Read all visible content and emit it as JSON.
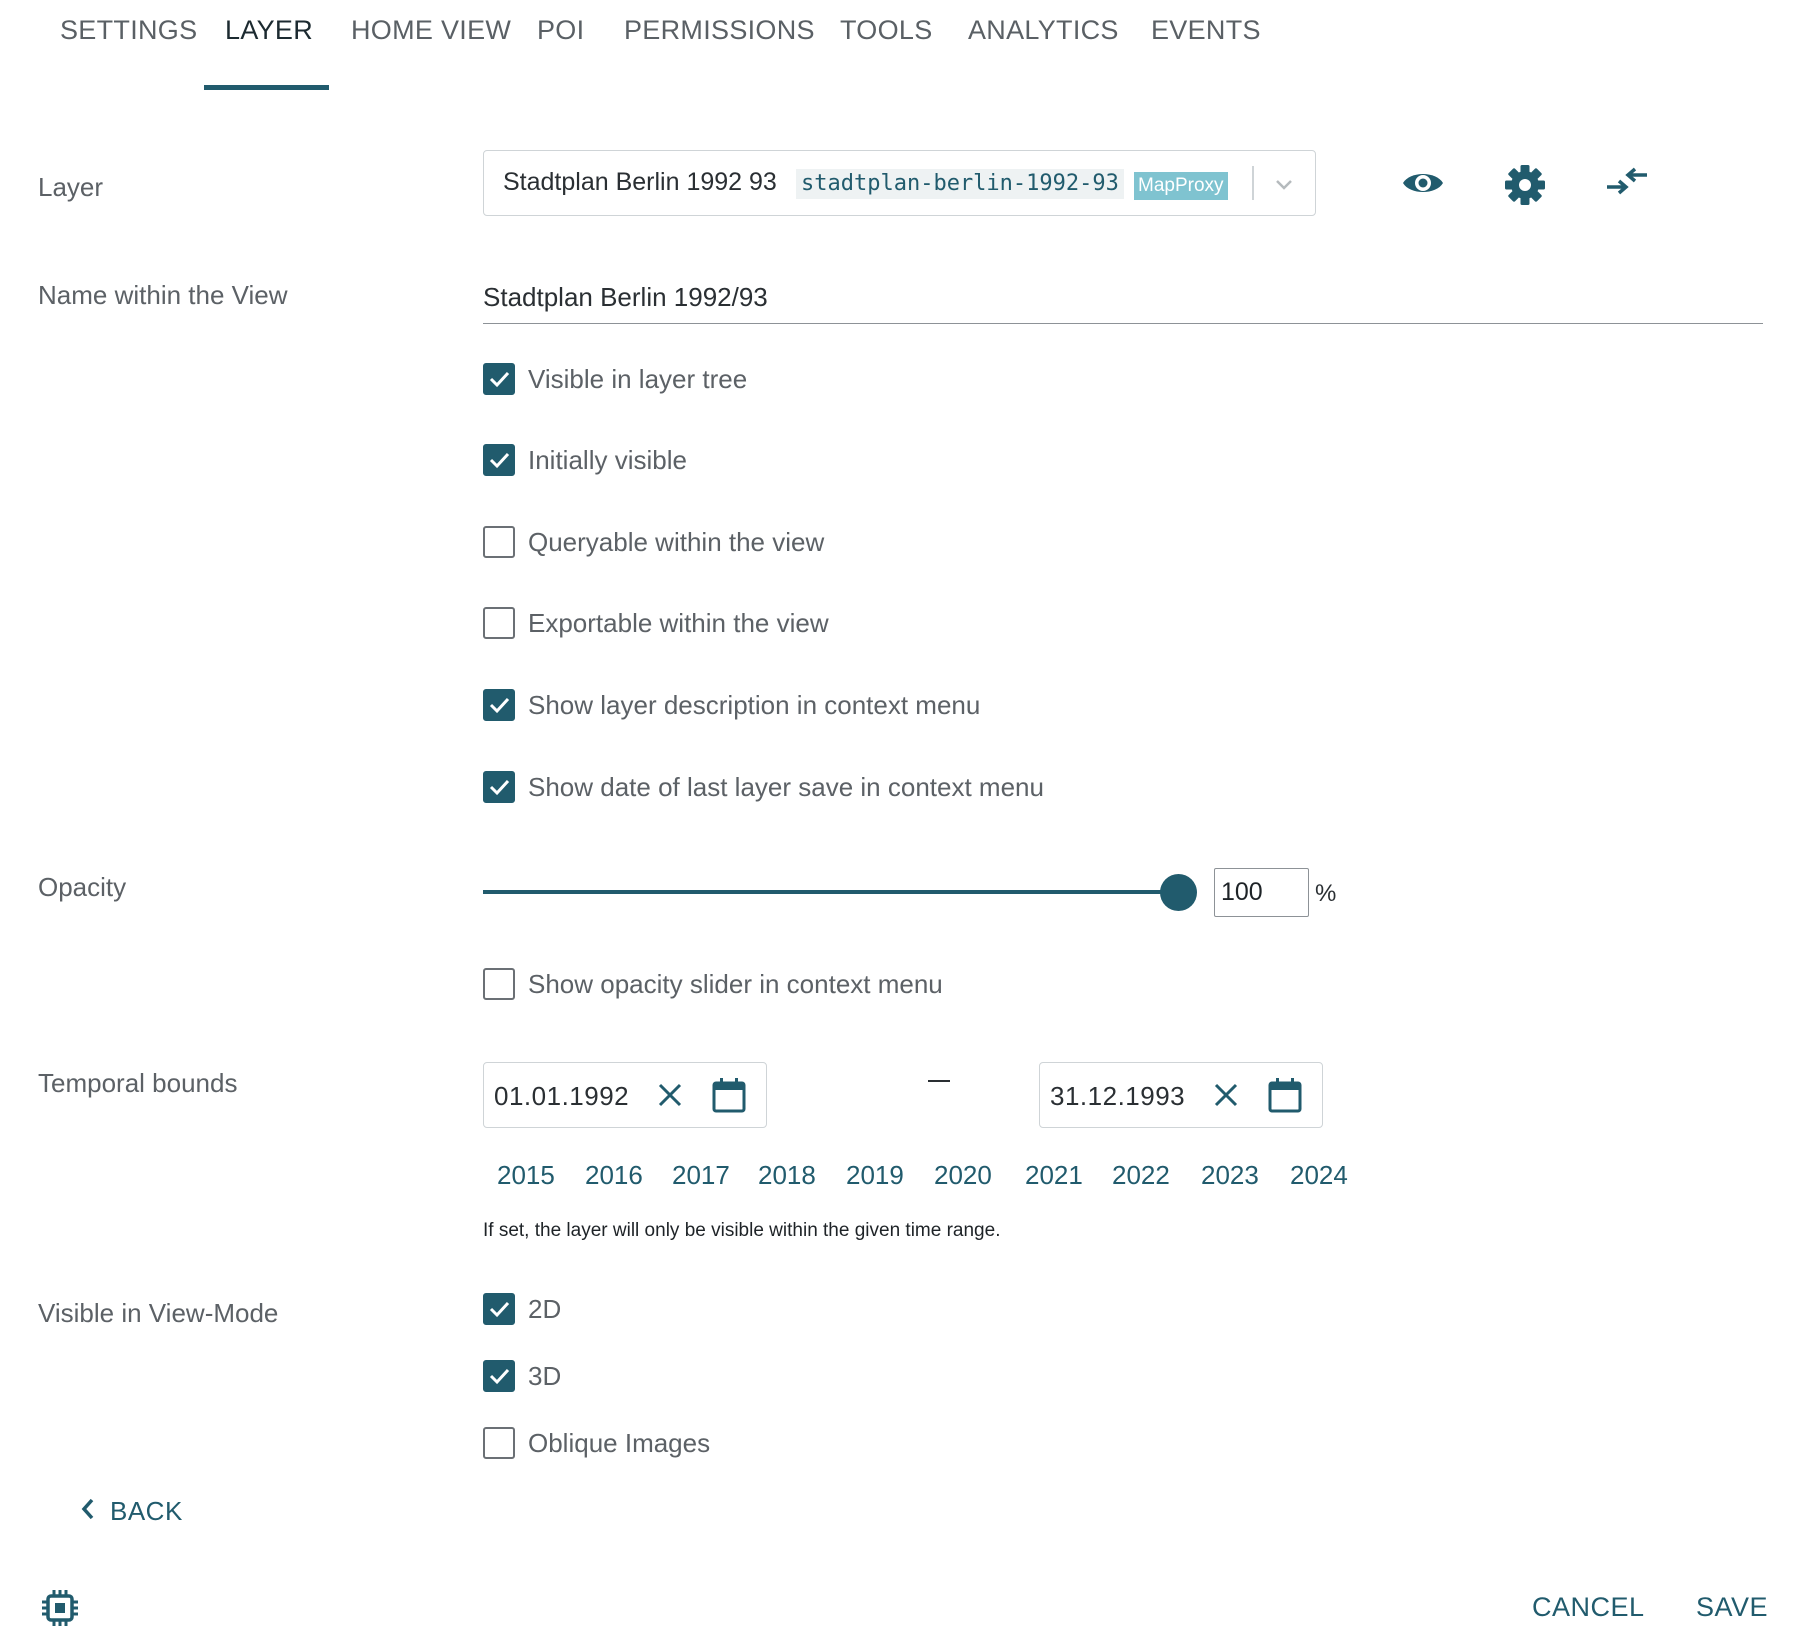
{
  "tabs": [
    {
      "label": "SETTINGS"
    },
    {
      "label": "LAYER",
      "active": true
    },
    {
      "label": "HOME VIEW"
    },
    {
      "label": "POI"
    },
    {
      "label": "PERMISSIONS"
    },
    {
      "label": "TOOLS"
    },
    {
      "label": "ANALYTICS"
    },
    {
      "label": "EVENTS"
    }
  ],
  "layer": {
    "label": "Layer",
    "select": {
      "title": "Stadtplan Berlin 1992 93",
      "id": "stadtplan-berlin-1992-93",
      "badge": "MapProxy"
    },
    "actions": [
      "eye-icon",
      "gear-icon",
      "compare-arrows-icon"
    ]
  },
  "name_field": {
    "label": "Name within the View",
    "value": "Stadtplan Berlin 1992/93"
  },
  "options": [
    {
      "label": "Visible in layer tree",
      "checked": true
    },
    {
      "label": "Initially visible",
      "checked": true
    },
    {
      "label": "Queryable within the view",
      "checked": false
    },
    {
      "label": "Exportable within the view",
      "checked": false
    },
    {
      "label": "Show layer description in context menu",
      "checked": true
    },
    {
      "label": "Show date of last layer save in context menu",
      "checked": true
    }
  ],
  "opacity": {
    "label": "Opacity",
    "value": "100",
    "unit": "%",
    "slider_option": {
      "label": "Show opacity slider in context menu",
      "checked": false
    }
  },
  "temporal": {
    "label": "Temporal bounds",
    "start": "01.01.1992",
    "end": "31.12.1993",
    "years": [
      "2015",
      "2016",
      "2017",
      "2018",
      "2019",
      "2020",
      "2021",
      "2022",
      "2023",
      "2024"
    ],
    "hint": "If set, the layer will only be visible within the given time range."
  },
  "view_mode": {
    "label": "Visible in View-Mode",
    "options": [
      {
        "label": "2D",
        "checked": true
      },
      {
        "label": "3D",
        "checked": true
      },
      {
        "label": "Oblique Images",
        "checked": false
      }
    ]
  },
  "actions": {
    "back": "BACK",
    "cancel": "CANCEL",
    "save": "SAVE"
  },
  "colors": {
    "accent": "#215b6d",
    "badge": "#7fc3d0",
    "text": "#5c6166"
  }
}
